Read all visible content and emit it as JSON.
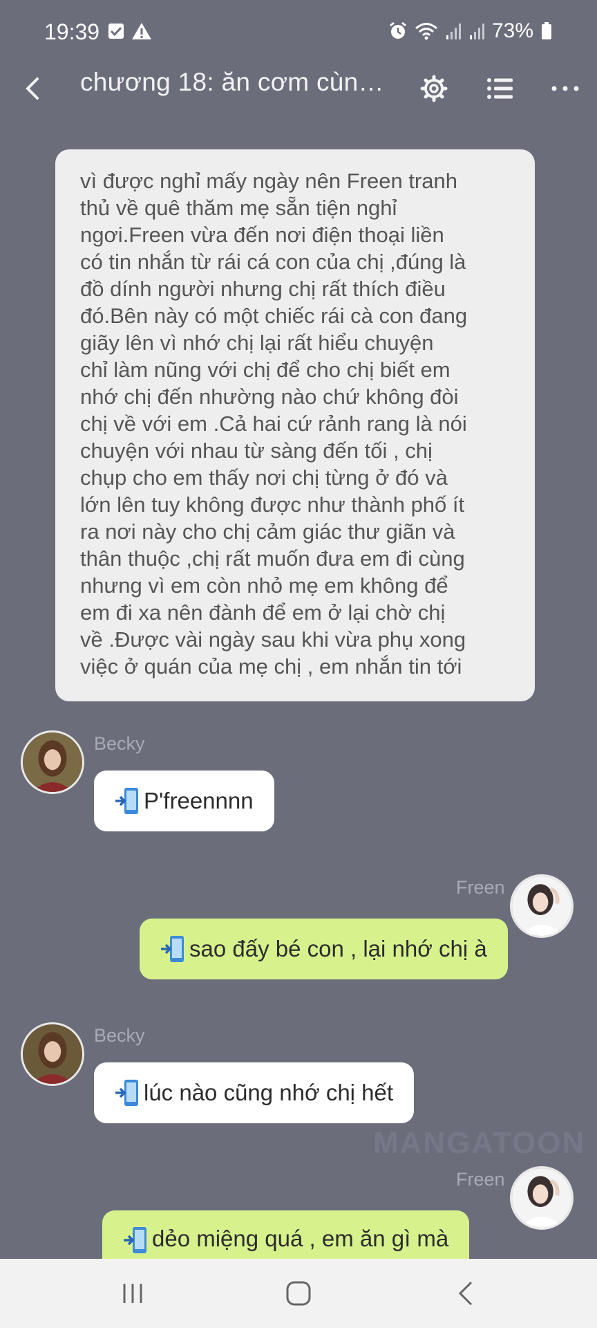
{
  "status_bar": {
    "time": "19:39",
    "battery": "73%",
    "icons": [
      "checkbox-icon",
      "warning-icon",
      "alarm-icon",
      "wifi-icon",
      "signal-icon",
      "signal-icon",
      "battery-icon"
    ]
  },
  "app_bar": {
    "title": "chương 18: ăn cơm cùng ...",
    "icons": [
      "back-icon",
      "settings-icon",
      "chapter-list-icon",
      "more-icon"
    ]
  },
  "narration": {
    "lines": [
      "vì được nghỉ mấy ngày nên Freen tranh",
      "thủ về quê thăm mẹ sẵn tiện nghỉ",
      "ngơi.Freen vừa đến nơi điện thoại liền",
      "có tin nhắn từ rái cá con của chị ,đúng là",
      "đồ dính người nhưng chị rất thích điều",
      "đó.Bên này có một chiếc rái cà con đang",
      "giãy lên vì nhớ chị lại rất hiểu chuyện",
      "chỉ làm nũng với chị để cho chị biết em",
      "nhớ chị đến nhường nào chứ không đòi",
      "chị về với em .Cả hai cứ rảnh rang là nói",
      "chuyện với nhau từ sàng đến tối , chị",
      "chụp cho em thấy nơi chị từng ở đó và",
      "lớn lên tuy không được như thành phố ít",
      "ra nơi này cho chị cảm giác thư giãn và",
      "thân thuộc ,chị rất muốn đưa em đi cùng",
      "nhưng vì em còn nhỏ mẹ em không để",
      "em đi xa nên đành để em ở lại chờ chị",
      "về .Được vài ngày sau khi vừa phụ xong",
      "việc ở quán của mẹ chị , em nhắn tin tới"
    ]
  },
  "messages": [
    {
      "sender": "Becky",
      "side": "left",
      "text": "P'freennnn"
    },
    {
      "sender": "Freen",
      "side": "right",
      "text": "sao đấy bé con , lại nhớ chị à"
    },
    {
      "sender": "Becky",
      "side": "left",
      "text": "lúc nào cũng nhớ chị hết"
    },
    {
      "sender": "Freen",
      "side": "right",
      "text": "dẻo miệng quá , em ăn gì mà"
    }
  ],
  "message_icon": "phone-message-icon",
  "watermark": "MANGATOON",
  "nav_bar": {
    "icons": [
      "recent-apps-icon",
      "home-icon",
      "nav-back-icon"
    ]
  },
  "colors": {
    "background": "#6b6d7b",
    "narration_bubble": "#eeeeee",
    "left_bubble": "#ffffff",
    "right_bubble": "#d7f28d",
    "sender_name": "#a9aab5"
  }
}
